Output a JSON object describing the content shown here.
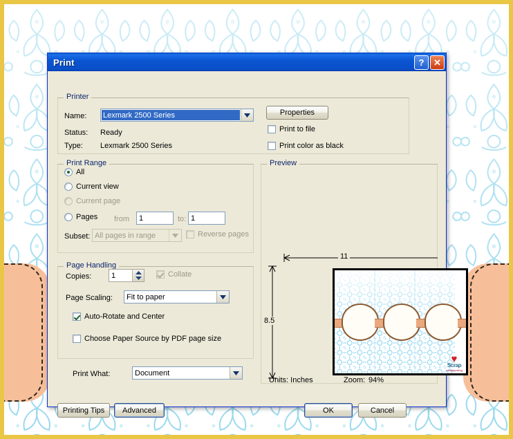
{
  "window": {
    "title": "Print",
    "help_button": "?",
    "close_button": "✕"
  },
  "printer": {
    "group_title": "Printer",
    "name_label": "Name:",
    "name_value": "Lexmark 2500 Series",
    "status_label": "Status:",
    "status_value": "Ready",
    "type_label": "Type:",
    "type_value": "Lexmark 2500 Series",
    "properties_button": "Properties",
    "print_to_file_label": "Print to file",
    "print_color_as_black_label": "Print color as black"
  },
  "print_range": {
    "group_title": "Print Range",
    "all_label": "All",
    "current_view_label": "Current view",
    "current_page_label": "Current page",
    "pages_label": "Pages",
    "from_label": "from",
    "from_value": "1",
    "to_label": "to:",
    "to_value": "1",
    "subset_label": "Subset:",
    "subset_value": "All pages in range",
    "reverse_pages_label": "Reverse pages"
  },
  "page_handling": {
    "group_title": "Page Handling",
    "copies_label": "Copies:",
    "copies_value": "1",
    "collate_label": "Collate",
    "page_scaling_label": "Page Scaling:",
    "page_scaling_value": "Fit to paper",
    "auto_rotate_label": "Auto-Rotate and Center",
    "choose_paper_source_label": "Choose Paper Source by PDF page size"
  },
  "print_what": {
    "label": "Print What:",
    "value": "Document"
  },
  "preview": {
    "group_title": "Preview",
    "width_dimension": "11",
    "height_dimension": "8.5",
    "units_label": "Units: Inches",
    "zoom_label": "Zoom:",
    "zoom_value": "94%",
    "logo_heart": "♥",
    "logo_word": "Scrap",
    "logo_sub": "scrapbooking"
  },
  "footer": {
    "printing_tips_button": "Printing Tips",
    "advanced_button": "Advanced",
    "ok_button": "OK",
    "cancel_button": "Cancel"
  },
  "colors": {
    "titlebar_blue": "#0b55d2",
    "dialog_face": "#ece9d8",
    "group_title_blue": "#0a246a",
    "wallpaper_border": "#e9c646",
    "damask_blue": "#6ec7e8",
    "peach": "#f6bf9a"
  }
}
